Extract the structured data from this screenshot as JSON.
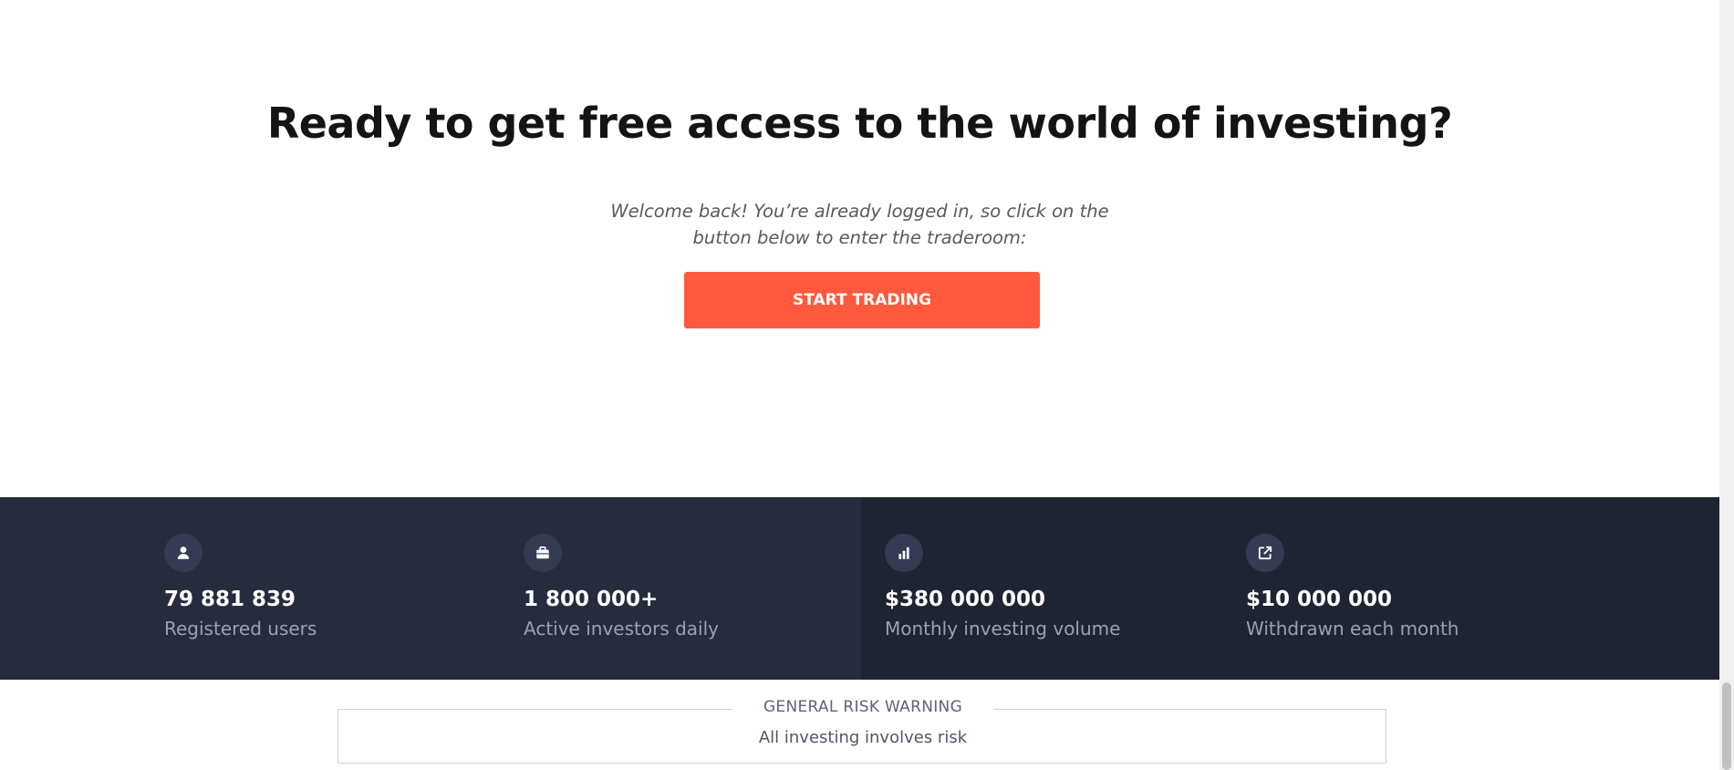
{
  "hero": {
    "title": "Ready to get free access to the world of investing?",
    "subtitle": "Welcome back! You’re already logged in, so click on the button below to enter the traderoom:",
    "cta_label": "START TRADING"
  },
  "stats": [
    {
      "icon": "user-icon",
      "value": "79 881 839",
      "label": "Registered users"
    },
    {
      "icon": "briefcase-icon",
      "value": "1 800 000+",
      "label": "Active investors daily"
    },
    {
      "icon": "bar-chart-icon",
      "value": "$380 000 000",
      "label": "Monthly investing volume"
    },
    {
      "icon": "external-link-icon",
      "value": "$10 000 000",
      "label": "Withdrawn each month"
    }
  ],
  "risk_warning": {
    "title": "GENERAL RISK WARNING",
    "text": "All investing involves risk"
  },
  "colors": {
    "accent": "#ff5a3d",
    "stats_dark": "#1f2433",
    "stats_light": "#262c3e"
  }
}
